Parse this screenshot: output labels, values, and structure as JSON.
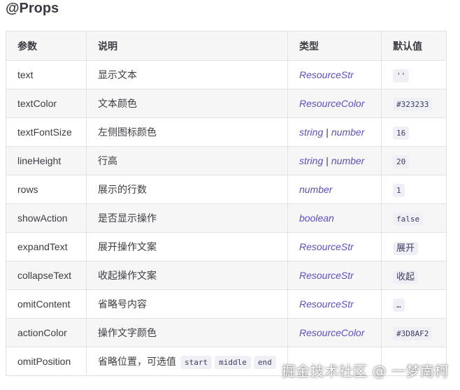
{
  "heading": "@Props",
  "table": {
    "headers": [
      "参数",
      "说明",
      "类型",
      "默认值"
    ],
    "rows": [
      {
        "param": "text",
        "desc": "显示文本",
        "types": [
          "ResourceStr"
        ],
        "default": "''"
      },
      {
        "param": "textColor",
        "desc": "文本颜色",
        "types": [
          "ResourceColor"
        ],
        "default": "#323233"
      },
      {
        "param": "textFontSize",
        "desc": "左侧图标颜色",
        "types": [
          "string",
          "number"
        ],
        "default": "16"
      },
      {
        "param": "lineHeight",
        "desc": "行高",
        "types": [
          "string",
          "number"
        ],
        "default": "20"
      },
      {
        "param": "rows",
        "desc": "展示的行数",
        "types": [
          "number"
        ],
        "default": "1"
      },
      {
        "param": "showAction",
        "desc": "是否显示操作",
        "types": [
          "boolean"
        ],
        "default": "false"
      },
      {
        "param": "expandText",
        "desc": "展开操作文案",
        "types": [
          "ResourceStr"
        ],
        "default": "展开"
      },
      {
        "param": "collapseText",
        "desc": "收起操作文案",
        "types": [
          "ResourceStr"
        ],
        "default": "收起"
      },
      {
        "param": "omitContent",
        "desc": "省略号内容",
        "types": [
          "ResourceStr"
        ],
        "default": "…"
      },
      {
        "param": "actionColor",
        "desc": "操作文字颜色",
        "types": [
          "ResourceColor"
        ],
        "default": "#3D8AF2"
      },
      {
        "param": "omitPosition",
        "desc": "省略位置，可选值",
        "desc_codes": [
          "start",
          "middle",
          "end"
        ],
        "types": [],
        "default": ""
      }
    ]
  },
  "watermark": "掘金技术社区 @ 一梦南柯"
}
